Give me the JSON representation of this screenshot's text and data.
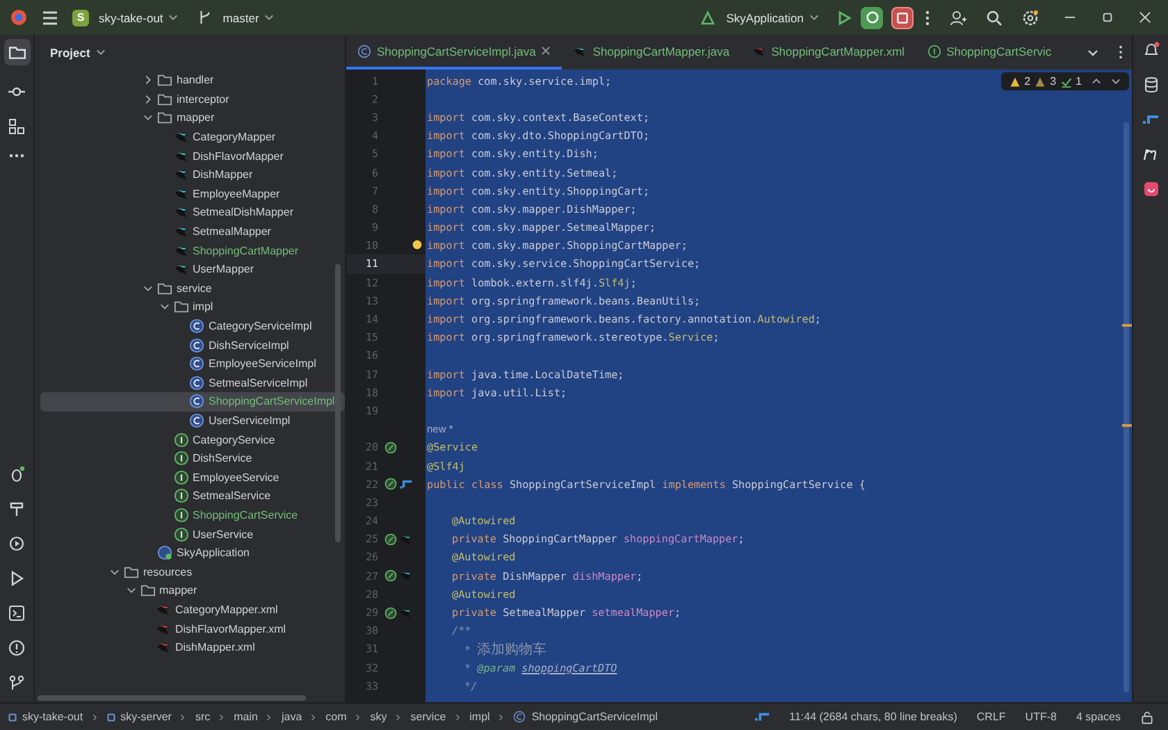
{
  "titlebar": {
    "project_badge": "S",
    "project": "sky-take-out",
    "branch": "master",
    "run_config": "SkyApplication"
  },
  "project": {
    "title": "Project",
    "tree_sky": [
      {
        "label": "handler",
        "kind": "folder",
        "expanded": false,
        "changed": false,
        "selected": false
      },
      {
        "label": "interceptor",
        "kind": "folder",
        "expanded": false,
        "changed": false,
        "selected": false
      },
      {
        "label": "mapper",
        "kind": "folder",
        "expanded": true,
        "changed": false,
        "selected": false,
        "children": [
          {
            "label": "CategoryMapper",
            "kind": "mapper",
            "changed": false,
            "selected": false
          },
          {
            "label": "DishFlavorMapper",
            "kind": "mapper",
            "changed": false,
            "selected": false
          },
          {
            "label": "DishMapper",
            "kind": "mapper",
            "changed": false,
            "selected": false
          },
          {
            "label": "EmployeeMapper",
            "kind": "mapper",
            "changed": false,
            "selected": false
          },
          {
            "label": "SetmealDishMapper",
            "kind": "mapper",
            "changed": false,
            "selected": false
          },
          {
            "label": "SetmealMapper",
            "kind": "mapper",
            "changed": false,
            "selected": false
          },
          {
            "label": "ShoppingCartMapper",
            "kind": "mapper",
            "changed": true,
            "selected": false
          },
          {
            "label": "UserMapper",
            "kind": "mapper",
            "changed": false,
            "selected": false
          }
        ]
      },
      {
        "label": "service",
        "kind": "folder",
        "expanded": true,
        "changed": false,
        "selected": false,
        "children": [
          {
            "label": "impl",
            "kind": "folder",
            "expanded": true,
            "changed": false,
            "selected": false,
            "children": [
              {
                "label": "CategoryServiceImpl",
                "kind": "class",
                "changed": false,
                "selected": false
              },
              {
                "label": "DishServiceImpl",
                "kind": "class",
                "changed": false,
                "selected": false
              },
              {
                "label": "EmployeeServiceImpl",
                "kind": "class",
                "changed": false,
                "selected": false
              },
              {
                "label": "SetmealServiceImpl",
                "kind": "class",
                "changed": false,
                "selected": false
              },
              {
                "label": "ShoppingCartServiceImpl",
                "kind": "class",
                "changed": true,
                "selected": true
              },
              {
                "label": "UserServiceImpl",
                "kind": "class",
                "changed": false,
                "selected": false
              }
            ]
          },
          {
            "label": "CategoryService",
            "kind": "interface",
            "changed": false,
            "selected": false
          },
          {
            "label": "DishService",
            "kind": "interface",
            "changed": false,
            "selected": false
          },
          {
            "label": "EmployeeService",
            "kind": "interface",
            "changed": false,
            "selected": false
          },
          {
            "label": "SetmealService",
            "kind": "interface",
            "changed": false,
            "selected": false
          },
          {
            "label": "ShoppingCartService",
            "kind": "interface",
            "changed": true,
            "selected": false
          },
          {
            "label": "UserService",
            "kind": "interface",
            "changed": false,
            "selected": false
          }
        ]
      },
      {
        "label": "SkyApplication",
        "kind": "app",
        "changed": false,
        "selected": false
      }
    ],
    "tree_resources": [
      {
        "label": "resources",
        "kind": "folder",
        "expanded": true,
        "changed": false,
        "selected": false,
        "children": [
          {
            "label": "mapper",
            "kind": "folder",
            "expanded": true,
            "changed": false,
            "selected": false,
            "children": [
              {
                "label": "CategoryMapper.xml",
                "kind": "xml",
                "changed": false,
                "selected": false
              },
              {
                "label": "DishFlavorMapper.xml",
                "kind": "xml",
                "changed": false,
                "selected": false
              },
              {
                "label": "DishMapper.xml",
                "kind": "xml",
                "changed": false,
                "selected": false
              }
            ]
          }
        ]
      }
    ]
  },
  "tabs": [
    {
      "label": "ShoppingCartServiceImpl.java",
      "kind": "class",
      "selected": true
    },
    {
      "label": "ShoppingCartMapper.java",
      "kind": "mapper",
      "selected": false
    },
    {
      "label": "ShoppingCartMapper.xml",
      "kind": "xml",
      "selected": false
    },
    {
      "label": "ShoppingCartServic",
      "kind": "interface",
      "selected": false
    }
  ],
  "inspections": {
    "warnings": "2",
    "weak_warnings": "3",
    "ok": "1"
  },
  "code": [
    {
      "n": "1",
      "kind": "top",
      "segs": [
        {
          "text": "package",
          "kind": "kw"
        },
        {
          "text": " com.sky.service.impl;",
          "kind": "pl"
        }
      ]
    },
    {
      "n": "2",
      "kind": "top"
    },
    {
      "n": "3",
      "kind": "top",
      "segs": [
        {
          "text": "import",
          "kind": "kw"
        },
        {
          "text": " com.sky.context.BaseContext;",
          "kind": "pl"
        }
      ]
    },
    {
      "n": "4",
      "kind": "top",
      "segs": [
        {
          "text": "import",
          "kind": "kw"
        },
        {
          "text": " com.sky.dto.ShoppingCartDTO;",
          "kind": "pl"
        }
      ]
    },
    {
      "n": "5",
      "kind": "top",
      "segs": [
        {
          "text": "import",
          "kind": "kw"
        },
        {
          "text": " com.sky.entity.Dish;",
          "kind": "pl"
        }
      ]
    },
    {
      "n": "6",
      "kind": "top",
      "segs": [
        {
          "text": "import",
          "kind": "kw"
        },
        {
          "text": " com.sky.entity.Setmeal;",
          "kind": "pl"
        }
      ]
    },
    {
      "n": "7",
      "kind": "top",
      "segs": [
        {
          "text": "import",
          "kind": "kw"
        },
        {
          "text": " com.sky.entity.ShoppingCart;",
          "kind": "pl"
        }
      ]
    },
    {
      "n": "8",
      "kind": "top",
      "segs": [
        {
          "text": "import",
          "kind": "kw"
        },
        {
          "text": " com.sky.mapper.DishMapper;",
          "kind": "pl"
        }
      ]
    },
    {
      "n": "9",
      "kind": "top",
      "segs": [
        {
          "text": "import",
          "kind": "kw"
        },
        {
          "text": " com.sky.mapper.SetmealMapper;",
          "kind": "pl"
        }
      ]
    },
    {
      "n": "10",
      "kind": "top",
      "bulb": true,
      "segs": [
        {
          "text": "import",
          "kind": "kw"
        },
        {
          "text": " com.sky.mapper.ShoppingCartMapper;",
          "kind": "pl"
        }
      ]
    },
    {
      "n": "11",
      "kind": "top",
      "caret": true,
      "segs": [
        {
          "text": "import",
          "kind": "kw"
        },
        {
          "text": " com.sky.service.ShoppingCartService;",
          "kind": "pl"
        }
      ]
    },
    {
      "n": "12",
      "kind": "top",
      "segs": [
        {
          "text": "import",
          "kind": "kw"
        },
        {
          "text": " lombok.extern.slf4j.",
          "kind": "pl"
        },
        {
          "text": "Slf4j",
          "kind": "an"
        },
        {
          "text": ";",
          "kind": "pl"
        }
      ]
    },
    {
      "n": "13",
      "kind": "top",
      "segs": [
        {
          "text": "import",
          "kind": "kw"
        },
        {
          "text": " org.springframework.beans.BeanUtils;",
          "kind": "pl"
        }
      ]
    },
    {
      "n": "14",
      "kind": "top",
      "segs": [
        {
          "text": "import",
          "kind": "kw"
        },
        {
          "text": " org.springframework.beans.factory.annotation.",
          "kind": "pl"
        },
        {
          "text": "Autowired",
          "kind": "an"
        },
        {
          "text": ";",
          "kind": "pl"
        }
      ]
    },
    {
      "n": "15",
      "kind": "top",
      "segs": [
        {
          "text": "import",
          "kind": "kw"
        },
        {
          "text": " org.springframework.stereotype.",
          "kind": "pl"
        },
        {
          "text": "Service",
          "kind": "an"
        },
        {
          "text": ";",
          "kind": "pl"
        }
      ]
    },
    {
      "n": "16",
      "kind": "top"
    },
    {
      "n": "17",
      "kind": "top",
      "segs": [
        {
          "text": "import",
          "kind": "kw"
        },
        {
          "text": " java.time.LocalDateTime;",
          "kind": "pl"
        }
      ]
    },
    {
      "n": "18",
      "kind": "top",
      "segs": [
        {
          "text": "import",
          "kind": "kw"
        },
        {
          "text": " java.util.List;",
          "kind": "pl"
        }
      ]
    },
    {
      "n": "19",
      "kind": "top"
    },
    {
      "kind": "top",
      "inlay": "new *"
    },
    {
      "n": "20",
      "kind": "top",
      "marks": [
        {
          "kind": "bean"
        }
      ],
      "segs": [
        {
          "text": "@Service",
          "kind": "an"
        }
      ]
    },
    {
      "n": "21",
      "kind": "top",
      "segs": [
        {
          "text": "@Slf4j",
          "kind": "an"
        }
      ]
    },
    {
      "n": "22",
      "kind": "top",
      "marks": [
        {
          "kind": "bean"
        },
        {
          "kind": "implemented"
        }
      ],
      "segs": [
        {
          "text": "public class",
          "kind": "kw"
        },
        {
          "text": " ShoppingCartServiceImpl ",
          "kind": "pl"
        },
        {
          "text": "implements",
          "kind": "kw"
        },
        {
          "text": " ShoppingCartService {",
          "kind": "pl"
        }
      ]
    },
    {
      "n": "23",
      "kind": "top"
    },
    {
      "n": "24",
      "kind": "body",
      "segs": [
        {
          "text": "@Autowired",
          "kind": "an"
        }
      ]
    },
    {
      "n": "25",
      "kind": "body",
      "marks": [
        {
          "kind": "bean"
        },
        {
          "kind": "mapper"
        }
      ],
      "segs": [
        {
          "text": "private",
          "kind": "kw"
        },
        {
          "text": " ShoppingCartMapper ",
          "kind": "pl"
        },
        {
          "text": "shoppingCartMapper",
          "kind": "fd"
        },
        {
          "text": ";",
          "kind": "pl"
        }
      ]
    },
    {
      "n": "26",
      "kind": "body",
      "segs": [
        {
          "text": "@Autowired",
          "kind": "an"
        }
      ]
    },
    {
      "n": "27",
      "kind": "body",
      "marks": [
        {
          "kind": "bean"
        },
        {
          "kind": "mapper"
        }
      ],
      "segs": [
        {
          "text": "private",
          "kind": "kw"
        },
        {
          "text": " DishMapper ",
          "kind": "pl"
        },
        {
          "text": "dishMapper",
          "kind": "fd"
        },
        {
          "text": ";",
          "kind": "pl"
        }
      ]
    },
    {
      "n": "28",
      "kind": "body",
      "segs": [
        {
          "text": "@Autowired",
          "kind": "an"
        }
      ]
    },
    {
      "n": "29",
      "kind": "body",
      "marks": [
        {
          "kind": "bean"
        },
        {
          "kind": "mapper"
        }
      ],
      "segs": [
        {
          "text": "private",
          "kind": "kw"
        },
        {
          "text": " SetmealMapper ",
          "kind": "pl"
        },
        {
          "text": "setmealMapper",
          "kind": "fd"
        },
        {
          "text": ";",
          "kind": "pl"
        }
      ]
    },
    {
      "n": "30",
      "kind": "body",
      "segs": [
        {
          "text": "/**",
          "kind": "cm"
        }
      ]
    },
    {
      "n": "31",
      "kind": "doc",
      "segs": [
        {
          "text": "* ",
          "kind": "cm"
        },
        {
          "text": "添加购物车",
          "kind": "cj"
        }
      ]
    },
    {
      "n": "32",
      "kind": "doc",
      "segs": [
        {
          "text": "* ",
          "kind": "cm"
        },
        {
          "text": "@param",
          "kind": "dt"
        },
        {
          "text": "shoppingCartDTO",
          "kind": "dp"
        }
      ]
    },
    {
      "n": "33",
      "kind": "doc",
      "segs": [
        {
          "text": "*/",
          "kind": "cm"
        }
      ]
    }
  ],
  "breadcrumbs": [
    "sky-take-out",
    "sky-server",
    "src",
    "main",
    "java",
    "com",
    "sky",
    "service",
    "impl",
    "ShoppingCartServiceImpl"
  ],
  "status": {
    "position": "11:44 (2684 chars, 80 line breaks)",
    "line_separator": "CRLF",
    "encoding": "UTF-8",
    "indent": "4 spaces"
  }
}
